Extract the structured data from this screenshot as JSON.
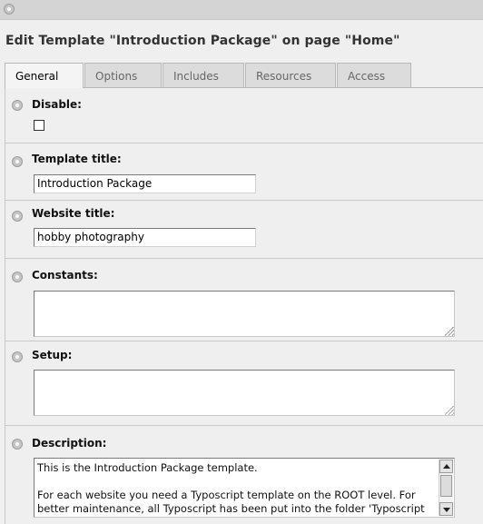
{
  "page": {
    "title": "Edit Template \"Introduction Package\" on page \"Home\""
  },
  "tabs": [
    {
      "label": "General",
      "active": true
    },
    {
      "label": "Options",
      "active": false
    },
    {
      "label": "Includes",
      "active": false
    },
    {
      "label": "Resources",
      "active": false
    },
    {
      "label": "Access",
      "active": false
    }
  ],
  "fields": {
    "disable": {
      "label": "Disable:",
      "checked": false
    },
    "template_title": {
      "label": "Template title:",
      "value": "Introduction Package"
    },
    "website_title": {
      "label": "Website title:",
      "value": "hobby photography"
    },
    "constants": {
      "label": "Constants:",
      "value": ""
    },
    "setup": {
      "label": "Setup:",
      "value": ""
    },
    "description": {
      "label": "Description:",
      "line1": "This is the Introduction Package template.",
      "line2": "For each website you need a Typoscript template on the ROOT level. For",
      "line3": "better maintenance, all Typoscript has been put into the folder 'Typoscript"
    }
  },
  "icons": {
    "help": "help-icon",
    "checkbox": "checkbox-icon",
    "resize": "resize-grip-icon",
    "scroll_up": "scroll-up-arrow-icon",
    "scroll_down": "scroll-down-arrow-icon"
  },
  "colors": {
    "background": "#efefef",
    "toolbar": "#d4d4d4",
    "tab_inactive": "#dcdcdc",
    "tab_active": "#f4f4f4",
    "border": "#c9c9c9"
  }
}
